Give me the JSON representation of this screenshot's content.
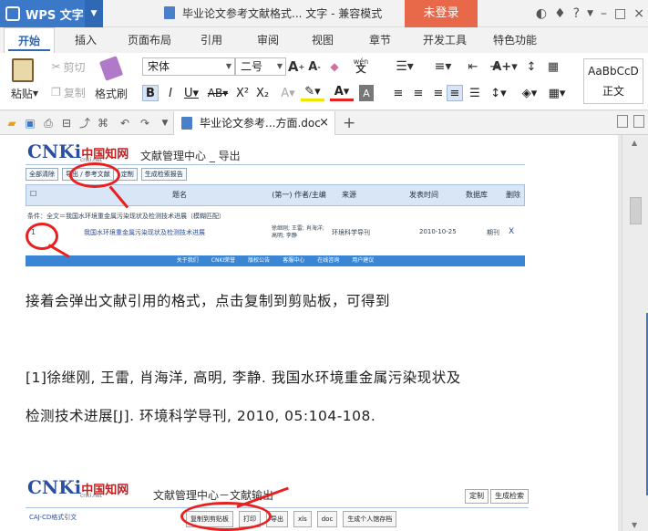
{
  "titlebar": {
    "app_name": "WPS 文字",
    "doc_title": "毕业论文参考文献格式... 文字 - 兼容模式",
    "login_label": "未登录",
    "icons": [
      "skin-icon",
      "shirt-icon",
      "help-icon",
      "minimize-icon",
      "maximize-icon",
      "close-icon"
    ]
  },
  "tabs": [
    "开始",
    "插入",
    "页面布局",
    "引用",
    "审阅",
    "视图",
    "章节",
    "开发工具",
    "特色功能"
  ],
  "ribbon": {
    "paste": "粘贴",
    "cut": "剪切",
    "copy": "复制",
    "format_painter": "格式刷",
    "font_name": "宋体",
    "font_size": "二号",
    "wen": "wén",
    "style_preview": "AaBbCcD",
    "style_name": "正文"
  },
  "quickbar": {
    "doc_tab": "毕业论文参考...方面.doc"
  },
  "cnki1": {
    "logo_c": "CNKi",
    "logo_cn": "中国知网",
    "logo_sub": "cnki.net",
    "subtitle": "文献管理中心 _ 导出",
    "tabs": [
      "全部清除",
      "导出 / 参考文献",
      "定制",
      "生成检索报告"
    ],
    "headers": [
      "题名",
      "(第一) 作者/主编",
      "来源",
      "发表时间",
      "数据库",
      "删除"
    ],
    "row1": "条件：全文＝我国水环境重金属污染现状及检测技术进展（模糊匹配）",
    "row2_num": "1",
    "row2_title": "我国水环境重金属污染现状及检测技术进展",
    "row2_author": "徐继刚; 王雷; 肖海洋; 高明; 李静",
    "row2_source": "环境科学导刊",
    "row2_date": "2010-10-25",
    "row2_db": "期刊",
    "row2_del": "X",
    "footer": [
      "关于我们",
      "CNKI荣誉",
      "版权公告",
      "客服中心",
      "在线咨询",
      "用户建议"
    ]
  },
  "body": {
    "p1": "接着会弹出文献引用的格式，点击复制到剪贴板，可得到",
    "p2": "[1]徐继刚, 王雷, 肖海洋, 高明, 李静.  我国水环境重金属污染现状及",
    "p3": "检测技术进展[J].  环境科学导刊, 2010, 05:104-108."
  },
  "cnki2": {
    "logo_c": "CNKi",
    "logo_cn": "中国知网",
    "logo_sub": "cnki.net",
    "subtitle": "文献管理中心－文献输出",
    "right_btns": [
      "定制",
      "生成检索"
    ],
    "left_tab": "CAJ-CD格式引文",
    "toolbar": [
      "复制到剪贴板",
      "打印",
      "导出",
      "xls",
      "doc",
      "生成个人馆存档"
    ]
  },
  "colors": {
    "wps_blue": "#3c78c8",
    "login_red": "#e8684a",
    "annotation_red": "#e82020",
    "cnki_blue": "#2a4ea1"
  }
}
